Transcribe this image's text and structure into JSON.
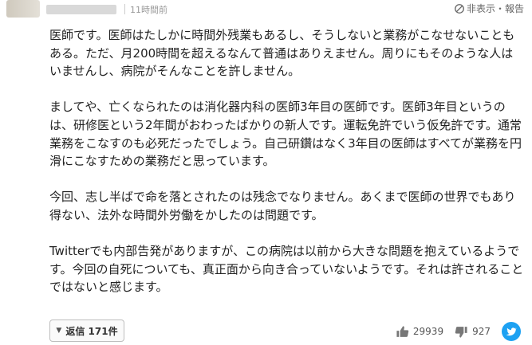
{
  "header": {
    "time": "11時間前",
    "report_label": "非表示・報告"
  },
  "comment": {
    "paragraphs": [
      "医師です。医師はたしかに時間外残業もあるし、そうしないと業務がこなせないこともある。ただ、月200時間を超えるなんて普通はありえません。周りにもそのような人はいませんし、病院がそんなことを許しません。",
      "ましてや、亡くなられたのは消化器内科の医師3年目の医師です。医師3年目というのは、研修医という2年間がおわったばかりの新人です。運転免許でいう仮免許です。通常業務をこなすのも必死だったでしょう。自己研鑽はなく3年目の医師はすべてが業務を円滑にこなすための業務だと思っています。",
      "今回、志し半ばで命を落とされたのは残念でなりません。あくまで医師の世界でもあり得ない、法外な時間外労働をかしたのは問題です。",
      "Twitterでも内部告発がありますが、この病院は以前から大きな問題を抱えているようです。今回の自死についても、真正面から向き合っていないようです。それは許されることではないと感じます。"
    ]
  },
  "footer": {
    "reply_label": "返信 171件",
    "likes": "29939",
    "dislikes": "927"
  },
  "icons": {
    "report": "block-icon",
    "like": "thumbs-up-icon",
    "dislike": "thumbs-down-icon",
    "share": "twitter-icon"
  },
  "colors": {
    "twitter": "#1da1f2",
    "text": "#222222",
    "muted": "#999999"
  }
}
